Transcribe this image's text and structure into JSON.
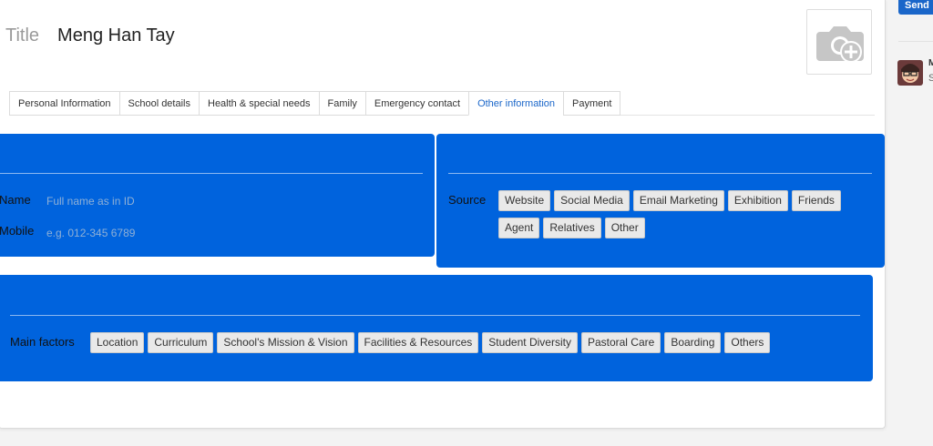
{
  "header": {
    "title_label": "Title",
    "title_value": "Meng Han Tay"
  },
  "tabs": [
    {
      "label": "Personal Information",
      "active": false
    },
    {
      "label": "School details",
      "active": false
    },
    {
      "label": "Health & special needs",
      "active": false
    },
    {
      "label": "Family",
      "active": false
    },
    {
      "label": "Emergency contact",
      "active": false
    },
    {
      "label": "Other information",
      "active": true
    },
    {
      "label": "Payment",
      "active": false
    }
  ],
  "contact_panel": {
    "heading": "",
    "name_label": "Name",
    "name_value": "",
    "name_placeholder": "Full name as in ID",
    "mobile_label": "Mobile",
    "mobile_value": "",
    "mobile_placeholder": "e.g. 012-345 6789"
  },
  "source_panel": {
    "heading": "",
    "source_label": "Source",
    "options": [
      "Website",
      "Social Media",
      "Email Marketing",
      "Exhibition",
      "Friends",
      "Agent",
      "Relatives",
      "Other"
    ]
  },
  "factors_panel": {
    "heading": "",
    "factors_label": "Main factors",
    "options": [
      "Location",
      "Curriculum",
      "School's Mission & Vision",
      "Facilities & Resources",
      "Student Diversity",
      "Pastoral Care",
      "Boarding",
      "Others"
    ]
  },
  "sidebar": {
    "send_label": "Send",
    "initial": "M",
    "sub": "S"
  },
  "colors": {
    "panel_blue": "#0063dd",
    "tab_active": "#1a66c9",
    "send_button": "#1a66c9",
    "chip_bg": "#e9e9e9"
  },
  "icons": {
    "photo": "add-photo-camera-icon",
    "avatar": "user-avatar-icon"
  }
}
